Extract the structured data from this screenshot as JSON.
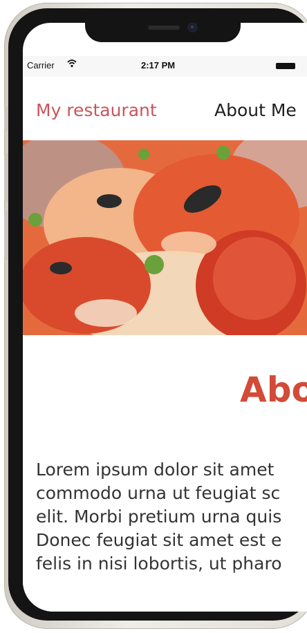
{
  "status_bar": {
    "carrier": "Carrier",
    "time": "2:17 PM",
    "wifi_icon": "wifi-icon",
    "battery_icon": "battery-icon"
  },
  "navbar": {
    "brand": "My restaurant",
    "link_about": "About Me"
  },
  "hero": {
    "image_subject": "pizza close-up photo",
    "colors": {
      "sauce": "#d8462e",
      "crust": "#f0c9a0",
      "olive": "#2a2a2a",
      "herb": "#6aa13a"
    }
  },
  "about": {
    "heading": "About",
    "paragraph_lines": [
      "Lorem ipsum dolor sit amet",
      "commodo urna ut feugiat sc",
      "elit. Morbi pretium urna quis",
      "Donec feugiat sit amet est e",
      "felis in nisi lobortis, ut pharo"
    ]
  },
  "colors": {
    "brand": "#c9555a",
    "heading": "#d24b38",
    "text": "#333333",
    "frame": "#141414"
  }
}
